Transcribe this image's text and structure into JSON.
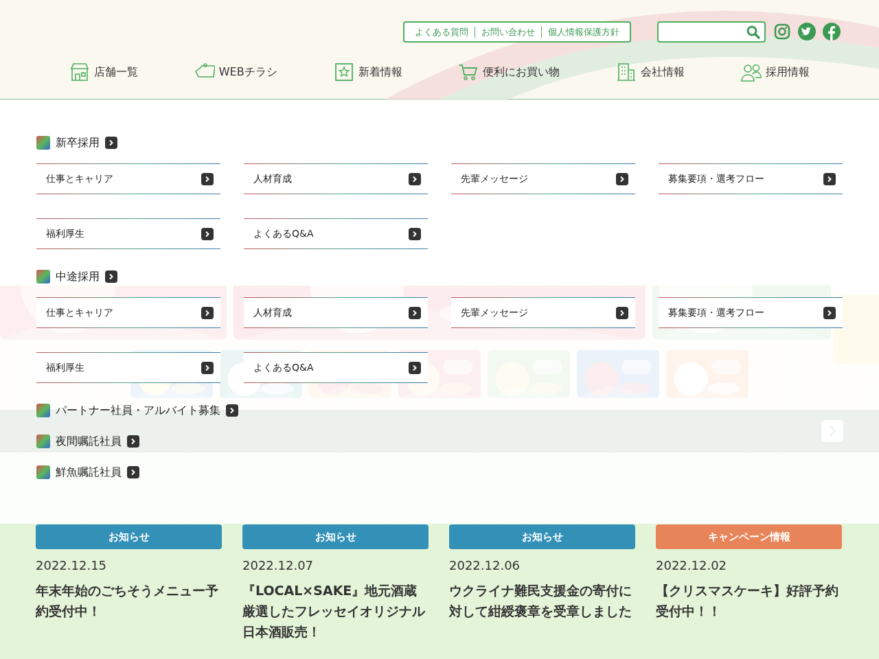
{
  "header": {
    "util_links": [
      "よくある質問",
      "お問い合わせ",
      "個人情報保護方針"
    ],
    "social": [
      {
        "kind": "instagram"
      },
      {
        "kind": "twitter"
      },
      {
        "kind": "facebook"
      }
    ],
    "nav": [
      {
        "label": "店舗一覧",
        "kind": "store"
      },
      {
        "label": "WEBチラシ",
        "kind": "tag"
      },
      {
        "label": "新着情報",
        "kind": "star"
      },
      {
        "label": "便利にお買い物",
        "kind": "cart"
      },
      {
        "label": "会社情報",
        "kind": "building"
      },
      {
        "label": "採用情報",
        "kind": "people"
      }
    ]
  },
  "news": {
    "cards": [
      {
        "category": "お知らせ",
        "color": "#3391b8",
        "date": "2022.12.15",
        "title": "年末年始のごちそうメニュー予約受付中！"
      },
      {
        "category": "お知らせ",
        "color": "#3391b8",
        "date": "2022.12.07",
        "title": "『LOCAL×SAKE』地元酒蔵厳選したフレッセイオリジナル日本酒販売！"
      },
      {
        "category": "お知らせ",
        "color": "#3391b8",
        "date": "2022.12.06",
        "title": "ウクライナ難民支援金の寄付に対して紺綬褒章を受章しました"
      },
      {
        "category": "キャンペーン情報",
        "color": "#e8845a",
        "date": "2022.12.02",
        "title": "【クリスマスケーキ】好評予約受付中！！"
      }
    ]
  },
  "menu": {
    "sections": [
      {
        "title": "新卒採用",
        "items": [
          "仕事とキャリア",
          "人材育成",
          "先輩メッセージ",
          "募集要項・選考フロー",
          "福利厚生",
          "よくあるQ&A"
        ]
      },
      {
        "title": "中途採用",
        "items": [
          "仕事とキャリア",
          "人材育成",
          "先輩メッセージ",
          "募集要項・選考フロー",
          "福利厚生",
          "よくあるQ&A"
        ]
      },
      {
        "title": "パートナー社員・アルバイト募集"
      },
      {
        "title": "夜間嘱託社員"
      },
      {
        "title": "鮮魚嘱託社員"
      }
    ]
  }
}
